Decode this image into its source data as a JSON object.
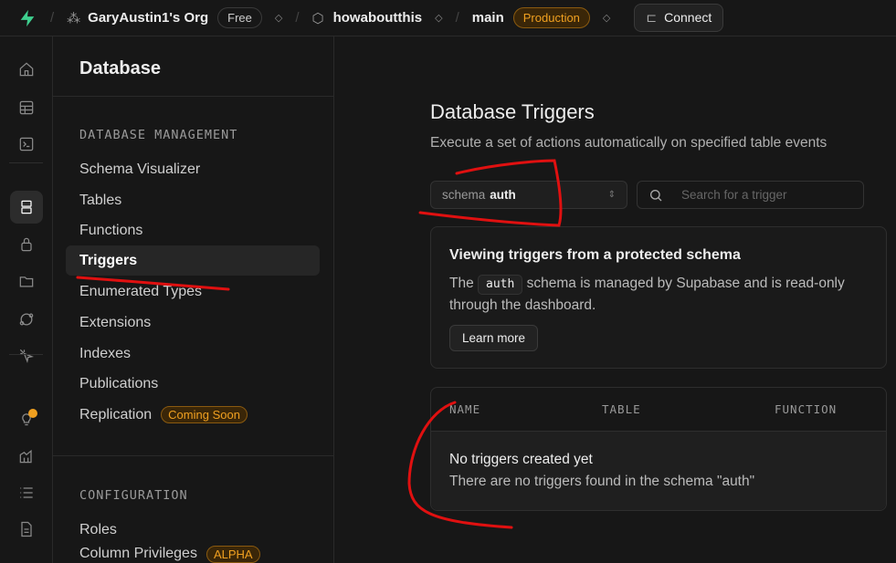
{
  "topbar": {
    "org": "GaryAustin1's Org",
    "org_plan": "Free",
    "project": "howaboutthis",
    "branch": "main",
    "env": "Production",
    "connect": "Connect"
  },
  "rail": [
    "home-icon",
    "table-editor-icon",
    "sql-editor-icon",
    "database-icon",
    "auth-icon",
    "storage-icon",
    "realtime-icon",
    "edge-functions-icon",
    "advisors-icon",
    "reports-icon",
    "logs-icon",
    "docs-icon"
  ],
  "menu": {
    "title": "Database",
    "section1": "DATABASE MANAGEMENT",
    "items": [
      {
        "label": "Schema Visualizer"
      },
      {
        "label": "Tables"
      },
      {
        "label": "Functions"
      },
      {
        "label": "Triggers"
      },
      {
        "label": "Enumerated Types"
      },
      {
        "label": "Extensions"
      },
      {
        "label": "Indexes"
      },
      {
        "label": "Publications"
      },
      {
        "label": "Replication",
        "badge": "Coming Soon"
      }
    ],
    "section2": "CONFIGURATION",
    "items2": [
      {
        "label": "Roles"
      },
      {
        "label": "Column Privileges",
        "badge": "ALPHA"
      }
    ]
  },
  "main": {
    "title": "Database Triggers",
    "subtitle": "Execute a set of actions automatically on specified table events",
    "schema_label": "schema",
    "schema_value": "auth",
    "search_placeholder": "Search for a trigger",
    "notice": {
      "title": "Viewing triggers from a protected schema",
      "pre": "The",
      "code": "auth",
      "post": "schema is managed by Supabase and is read-only through the dashboard.",
      "button": "Learn more"
    },
    "table": {
      "columns": [
        "NAME",
        "TABLE",
        "FUNCTION"
      ],
      "empty_title": "No triggers created yet",
      "empty_desc": "There are no triggers found in the schema \"auth\""
    }
  },
  "annotation_color": "#e01010"
}
